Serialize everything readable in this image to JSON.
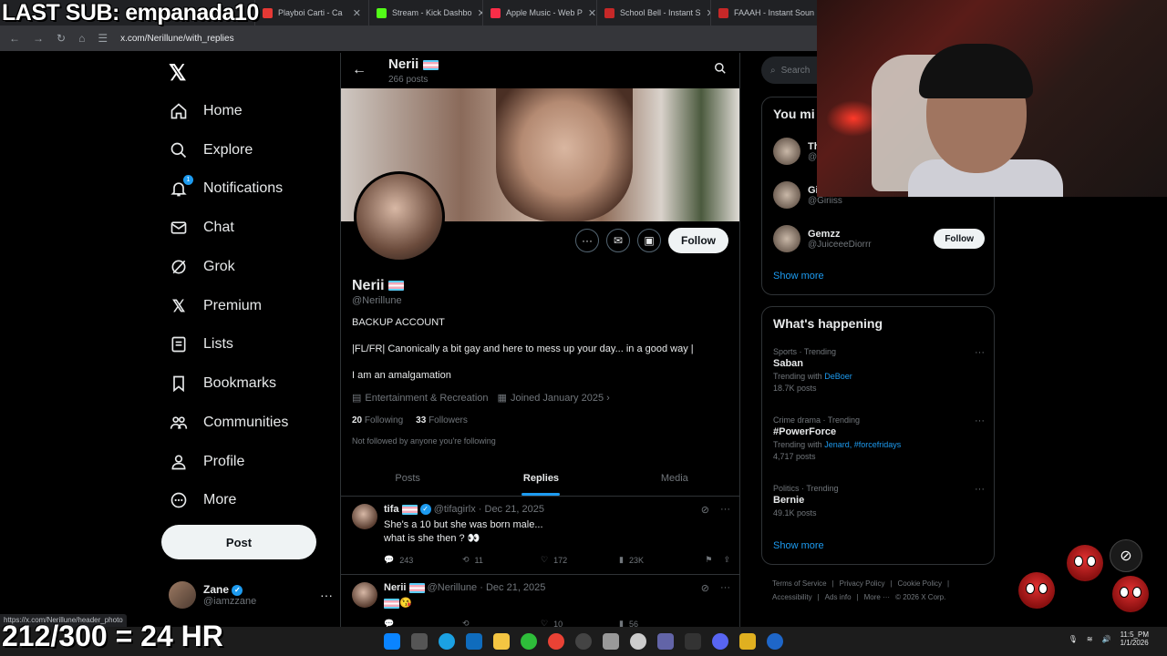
{
  "overlay": {
    "last_sub": "LAST SUB: empanada10",
    "subathon": "212/300 = 24 HR"
  },
  "browser": {
    "tabs": [
      {
        "label": "Playboi Carti - Ca",
        "color": "#e53935"
      },
      {
        "label": "Stream - Kick Dashbo",
        "color": "#53fc18"
      },
      {
        "label": "Apple Music - Web P",
        "color": "#fa2d48"
      },
      {
        "label": "School Bell - Instant S",
        "color": "#c62828"
      },
      {
        "label": "FAAAH - Instant Soun",
        "color": "#c62828"
      }
    ],
    "url": "x.com/Nerillune/with_replies",
    "status_url": "https://x.com/Nerillune/header_photo"
  },
  "nav": {
    "items": [
      {
        "label": "Home",
        "icon": "home-icon"
      },
      {
        "label": "Explore",
        "icon": "search-icon"
      },
      {
        "label": "Notifications",
        "icon": "bell-icon",
        "badge": "1"
      },
      {
        "label": "Chat",
        "icon": "mail-icon"
      },
      {
        "label": "Grok",
        "icon": "grok-icon"
      },
      {
        "label": "Premium",
        "icon": "x-icon"
      },
      {
        "label": "Lists",
        "icon": "list-icon"
      },
      {
        "label": "Bookmarks",
        "icon": "bookmark-icon"
      },
      {
        "label": "Communities",
        "icon": "people-icon"
      },
      {
        "label": "Profile",
        "icon": "person-icon"
      },
      {
        "label": "More",
        "icon": "more-circle-icon"
      }
    ],
    "post_label": "Post",
    "account": {
      "name": "Zane",
      "handle": "@iamzzane"
    }
  },
  "profile": {
    "name": "Nerii",
    "post_count": "266 posts",
    "handle": "@Nerillune",
    "follow_label": "Follow",
    "bio_line1": "BACKUP ACCOUNT",
    "bio_line2": "|FL/FR| Canonically a bit gay and here to mess up your day... in a good way |",
    "bio_line3": "I am an amalgamation",
    "category": "Entertainment & Recreation",
    "joined": "Joined January 2025",
    "following_count": "20",
    "following_label": "Following",
    "followers_count": "33",
    "followers_label": "Followers",
    "not_followed": "Not followed by anyone you're following",
    "tabs": [
      "Posts",
      "Replies",
      "Media"
    ],
    "active_tab": "Replies"
  },
  "tweets": [
    {
      "name": "tifa",
      "handle": "@tifagirlx",
      "date": "Dec 21, 2025",
      "text": "She's a 10 but she was born male...\nwhat is she then ? 👀",
      "replies": "243",
      "reposts": "11",
      "likes": "172",
      "views": "23K"
    },
    {
      "name": "Nerii",
      "handle": "@Nerillune",
      "date": "Dec 21, 2025",
      "text": "😘",
      "replies": "",
      "reposts": "",
      "likes": "10",
      "views": "56"
    }
  ],
  "sidebar": {
    "search_placeholder": "Search",
    "you_might_like": "You mi",
    "suggestions": [
      {
        "name": "Th",
        "handle": "@T"
      },
      {
        "name": "Gi",
        "handle": "@Giriiss"
      },
      {
        "name": "Gemzz",
        "handle": "@JuiceeeDiorrr"
      }
    ],
    "follow_label": "Follow",
    "show_more": "Show more",
    "whats_happening": "What's happening",
    "trends": [
      {
        "category": "Sports · Trending",
        "name": "Saban",
        "trending_with": "Trending with",
        "links": "DeBoer",
        "posts": "18.7K posts"
      },
      {
        "category": "Crime drama · Trending",
        "name": "#PowerForce",
        "trending_with": "Trending with",
        "links": "Jenard, #forcefridays",
        "posts": "4,717 posts"
      },
      {
        "category": "Politics · Trending",
        "name": "Bernie",
        "trending_with": "",
        "links": "",
        "posts": "49.1K posts"
      }
    ],
    "footer": [
      "Terms of Service",
      "Privacy Policy",
      "Cookie Policy",
      "Accessibility",
      "Ads info",
      "More ···",
      "© 2026 X Corp."
    ]
  },
  "taskbar": {
    "time": "11:5_PM",
    "date": "1/1/2026"
  }
}
